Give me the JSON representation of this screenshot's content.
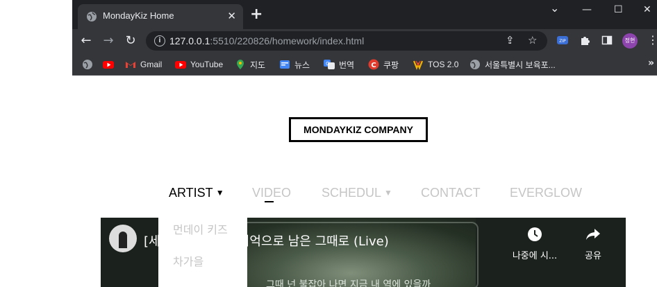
{
  "browser": {
    "tab": {
      "title": "MondayKiz Home",
      "close": "✕"
    },
    "new_tab": "+",
    "window_controls": {
      "chevron": "⌄",
      "minimize": "—",
      "maximize": "☐",
      "close": "✕"
    },
    "address": {
      "host": "127.0.0.1",
      "path": ":5510/220826/homework/index.html",
      "info": "i"
    },
    "profile": {
      "initials": "정현",
      "color": "#8e44ad"
    },
    "bookmarks": [
      {
        "label": "",
        "icon": "globe-icon",
        "color": "#9aa0a6"
      },
      {
        "label": "",
        "icon": "youtube-icon",
        "color": "#ff0000"
      },
      {
        "label": "Gmail",
        "icon": "gmail-icon",
        "color": "#ea4335"
      },
      {
        "label": "YouTube",
        "icon": "youtube-icon",
        "color": "#ff0000"
      },
      {
        "label": "지도",
        "icon": "maps-icon",
        "color": "#34a853"
      },
      {
        "label": "뉴스",
        "icon": "news-icon",
        "color": "#4285f4"
      },
      {
        "label": "번역",
        "icon": "translate-icon",
        "color": "#4285f4"
      },
      {
        "label": "쿠팡",
        "icon": "coupang-icon",
        "color": "#e23b2e"
      },
      {
        "label": "TOS 2.0",
        "icon": "tos-icon",
        "color": "#f4b400"
      },
      {
        "label": "서울특별시 보육포...",
        "icon": "globe-icon",
        "color": "#9aa0a6"
      }
    ],
    "bookmarks_more": "»"
  },
  "page": {
    "logo": "MONDAYKIZ COMPANY",
    "nav": [
      {
        "label": "ARTIST",
        "active": true,
        "caret": "▼"
      },
      {
        "label": "VIDEO",
        "active": false
      },
      {
        "label": "SCHEDUL",
        "active": false,
        "caret": "▼"
      },
      {
        "label": "CONTACT",
        "active": false
      },
      {
        "label": "EVERGLOW",
        "active": false
      }
    ],
    "dropdown": [
      "먼데이 키즈",
      "차가을"
    ],
    "video": {
      "title": "[세이 키즈 - 아픈 기억으로 남은 그때로 (Live)",
      "watch_later": "나중에 시...",
      "share": "공유",
      "subtitle": "그때 넌 불잡아 나면 지금 내 역에 있을까"
    }
  }
}
